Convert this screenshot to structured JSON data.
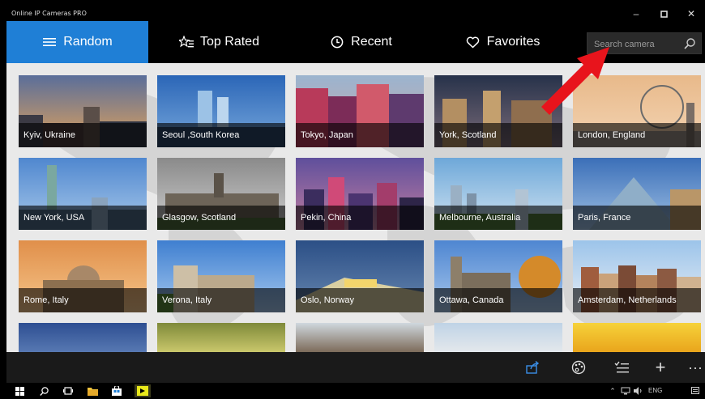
{
  "window": {
    "title": "Online IP Cameras PRO"
  },
  "nav": {
    "tabs": [
      {
        "label": "Random",
        "icon": "hamburger-icon",
        "active": true
      },
      {
        "label": "Top Rated",
        "icon": "star-list-icon",
        "active": false
      },
      {
        "label": "Recent",
        "icon": "clock-icon",
        "active": false
      },
      {
        "label": "Favorites",
        "icon": "heart-icon",
        "active": false
      }
    ],
    "search": {
      "placeholder": "Search camera"
    }
  },
  "cameras": [
    {
      "label": "Kyiv, Ukraine"
    },
    {
      "label": "Seoul ,South Korea"
    },
    {
      "label": "Tokyo, Japan"
    },
    {
      "label": "York, Scotland"
    },
    {
      "label": "London, England"
    },
    {
      "label": "New York, USA"
    },
    {
      "label": "Glasgow, Scotland"
    },
    {
      "label": "Pekin, China"
    },
    {
      "label": "Melbourne, Australia"
    },
    {
      "label": "Paris, France"
    },
    {
      "label": "Rome, Italy"
    },
    {
      "label": "Verona, Italy"
    },
    {
      "label": "Oslo, Norway"
    },
    {
      "label": "Ottawa, Canada"
    },
    {
      "label": "Amsterdam, Netherlands"
    }
  ],
  "taskbar": {
    "language": "ENG"
  },
  "colors": {
    "accent": "#1f7fd6",
    "arrow": "#e8141c"
  }
}
